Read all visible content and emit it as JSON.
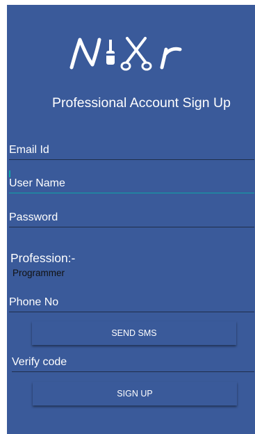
{
  "app": {
    "logo_text": "NiXr"
  },
  "header": {
    "title": "Professional Account Sign Up"
  },
  "form": {
    "email_placeholder": "Email Id",
    "username_placeholder": "User Name",
    "password_placeholder": "Password",
    "profession_label": "Profession:-",
    "profession_value": "Programmer",
    "phone_placeholder": "Phone No",
    "send_sms_label": "SEND SMS",
    "verify_placeholder": "Verify code",
    "signup_label": "SIGN UP"
  },
  "colors": {
    "background": "#3a5a9a",
    "focus_accent": "#0fa6a6",
    "text": "#ffffff"
  }
}
